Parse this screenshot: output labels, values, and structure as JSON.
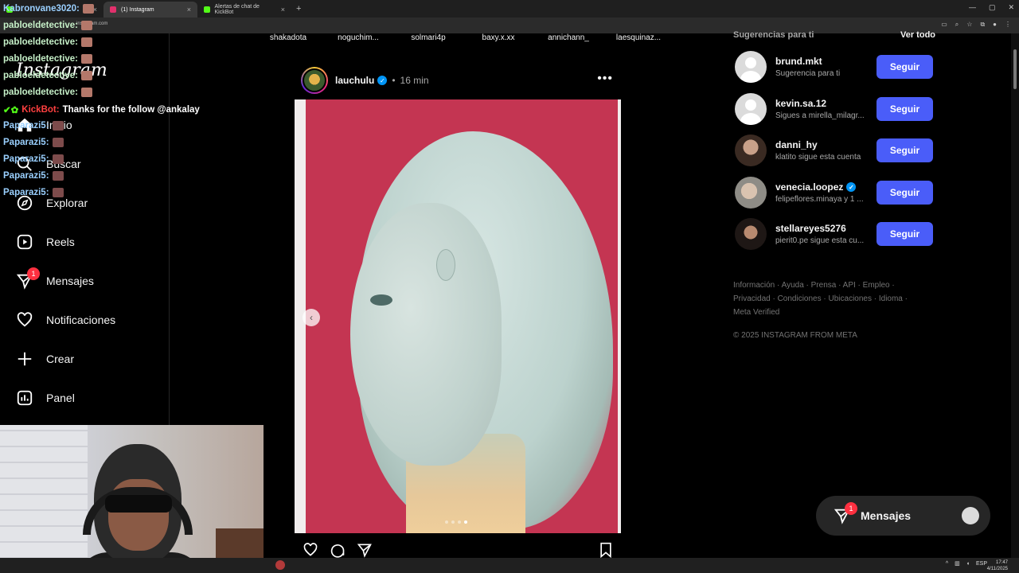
{
  "browser": {
    "tabs": [
      {
        "label": "(1) Instagram",
        "active": true
      },
      {
        "label": "Alertas de chat de KickBot",
        "active": false
      }
    ],
    "url": "instagram.com",
    "new_tab": "+",
    "close": "×"
  },
  "sidebar": {
    "logo": "Instagram",
    "items": [
      {
        "label": "Inicio",
        "icon": "home-icon"
      },
      {
        "label": "Buscar",
        "icon": "search-icon"
      },
      {
        "label": "Explorar",
        "icon": "compass-icon"
      },
      {
        "label": "Reels",
        "icon": "reels-icon"
      },
      {
        "label": "Mensajes",
        "icon": "messenger-icon",
        "badge": "1"
      },
      {
        "label": "Notificaciones",
        "icon": "heart-icon"
      },
      {
        "label": "Crear",
        "icon": "plus-icon"
      },
      {
        "label": "Panel",
        "icon": "chart-icon"
      }
    ]
  },
  "chat": [
    {
      "user": "Kabronvane3020:",
      "msg": ""
    },
    {
      "user": "pabloeldetective:",
      "msg": ""
    },
    {
      "user": "pabloeldetective:",
      "msg": ""
    },
    {
      "user": "pabloeldetective:",
      "msg": ""
    },
    {
      "user": "pabloeldetective:",
      "msg": ""
    },
    {
      "user": "pabloeldetective:",
      "msg": ""
    },
    {
      "user": "KickBot:",
      "msg": "Thanks for the follow @ankalay"
    },
    {
      "user": "Paparazi5:",
      "msg": ""
    },
    {
      "user": "Paparazi5:",
      "msg": ""
    },
    {
      "user": "Paparazi5:",
      "msg": ""
    },
    {
      "user": "Paparazi5:",
      "msg": ""
    },
    {
      "user": "Paparazi5:",
      "msg": ""
    }
  ],
  "stories": [
    "shakadota",
    "noguchim...",
    "solmari4p",
    "baxy.x.xx",
    "annichann_",
    "laesquinaz..."
  ],
  "post": {
    "username": "lauchulu",
    "verified_mark": "✓",
    "separator": "•",
    "time": "16 min",
    "more": "•••",
    "carousel_index": 4,
    "carousel_total": 4
  },
  "suggestions": {
    "title": "Sugerencias para ti",
    "see_all": "Ver todo",
    "follow_label": "Seguir",
    "items": [
      {
        "name": "brund.mkt",
        "sub": "Sugerencia para ti",
        "verified": false
      },
      {
        "name": "kevin.sa.12",
        "sub": "Sigues a mirella_milagr...",
        "verified": false
      },
      {
        "name": "danni_hy",
        "sub": "klatito sigue esta cuenta",
        "verified": false
      },
      {
        "name": "venecia.loopez",
        "sub": "felipeflores.minaya y 1 ...",
        "verified": true
      },
      {
        "name": "stellareyes5276",
        "sub": "pierit0.pe sigue esta cu...",
        "verified": false
      }
    ]
  },
  "footer": {
    "links": "Información · Ayuda · Prensa · API · Empleo · Privacidad · Condiciones · Ubicaciones · Idioma · Meta Verified",
    "copyright": "© 2025 INSTAGRAM FROM META"
  },
  "messages_pill": {
    "label": "Mensajes",
    "badge": "1"
  },
  "taskbar": {
    "lang": "ESP",
    "time": "17:47",
    "date": "4/11/2025"
  },
  "colors": {
    "accent": "#4a5df9",
    "badge": "#ff3040",
    "verified": "#0095f6",
    "background": "#000000"
  }
}
